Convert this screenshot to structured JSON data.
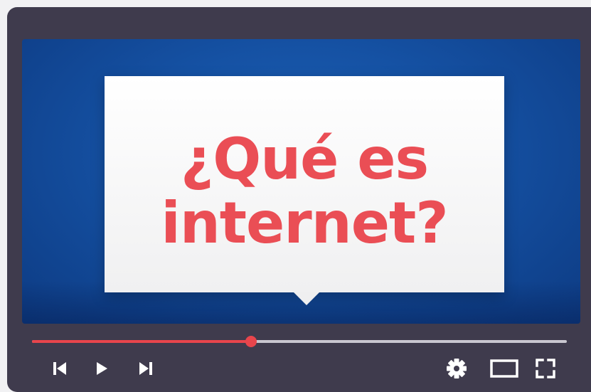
{
  "video": {
    "title_line1": "¿Qué es",
    "title_line2": "internet?"
  },
  "player": {
    "progress": 0.41,
    "colors": {
      "progress": "#e8454c",
      "accent_text": "#ea4e55",
      "frame": "#3f3b4d",
      "screen": "#1551a3"
    },
    "controls_left": [
      "skip-back-icon",
      "play-icon",
      "skip-forward-icon"
    ],
    "controls_right": [
      "gear-icon",
      "theater-mode-icon",
      "fullscreen-icon"
    ]
  }
}
